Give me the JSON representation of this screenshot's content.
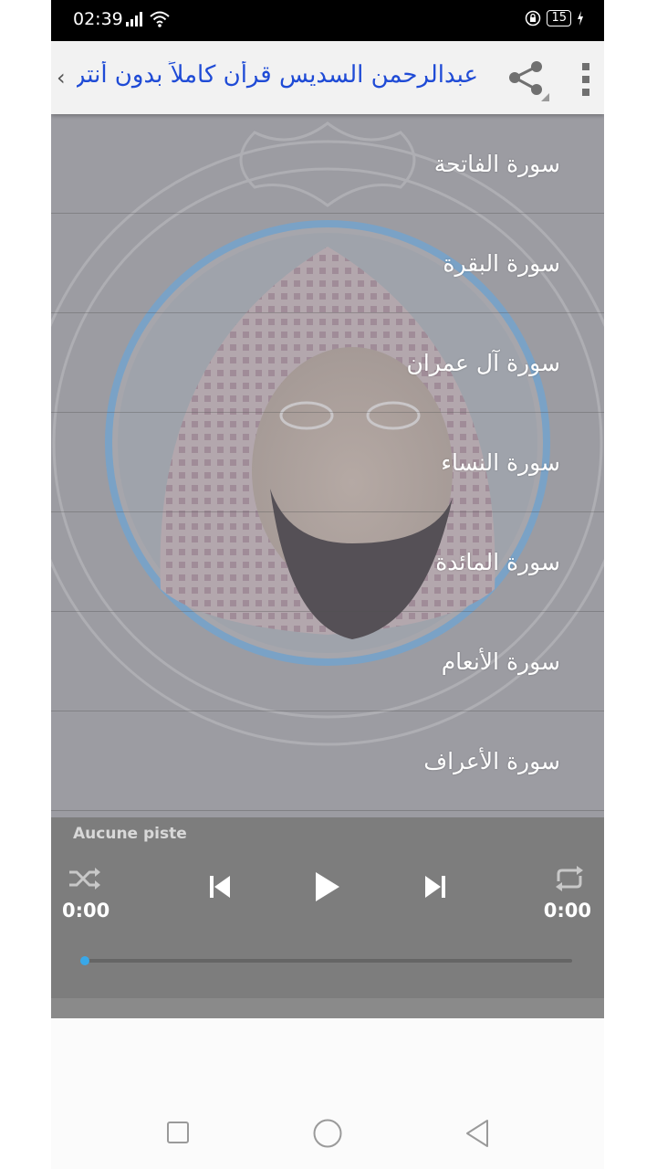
{
  "status": {
    "time": "02:39",
    "battery": "15"
  },
  "appbar": {
    "title": "عبدالرحمن السديس قرأن كاملاً بدون أنترنت",
    "chevron": "‹",
    "share_icon": "share-icon",
    "more_icon": "more-vert-icon"
  },
  "surahs": [
    "سورة الفاتحة",
    "سورة البقرة",
    "سورة آل عمران",
    "سورة النساء",
    "سورة المائدة",
    "سورة الأنعام",
    "سورة الأعراف"
  ],
  "player": {
    "track": "Aucune piste",
    "elapsed": "0:00",
    "duration": "0:00",
    "progress": 0,
    "accent": "#39a8e8"
  },
  "colors": {
    "title": "#1f4bd6",
    "statusbar": "#000000",
    "player": "#7d7d7d"
  }
}
